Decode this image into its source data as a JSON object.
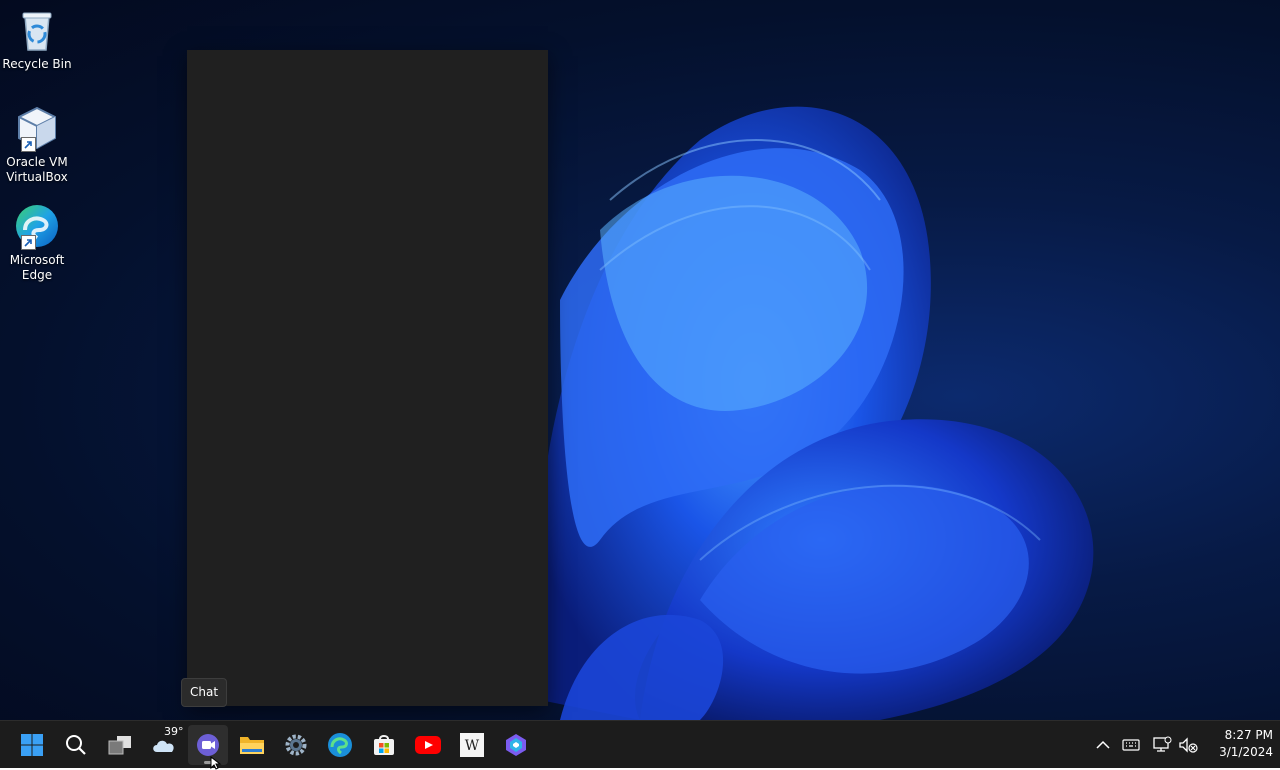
{
  "desktop": {
    "icons": [
      {
        "id": "recycle-bin",
        "label": "Recycle Bin"
      },
      {
        "id": "virtualbox",
        "label_line1": "Oracle VM",
        "label_line2": "VirtualBox"
      },
      {
        "id": "edge",
        "label_line1": "Microsoft",
        "label_line2": "Edge"
      }
    ]
  },
  "tooltip": {
    "text": "Chat"
  },
  "taskbar": {
    "apps": [
      {
        "name": "start",
        "icon": "windows-logo-icon"
      },
      {
        "name": "search",
        "icon": "search-icon"
      },
      {
        "name": "task-view",
        "icon": "task-view-icon"
      },
      {
        "name": "widgets",
        "icon": "cloud-icon"
      },
      {
        "name": "chat",
        "icon": "chat-icon",
        "active": true
      },
      {
        "name": "file-explorer",
        "icon": "folder-icon"
      },
      {
        "name": "settings",
        "icon": "gear-icon"
      },
      {
        "name": "edge",
        "icon": "edge-icon"
      },
      {
        "name": "microsoft-store",
        "icon": "store-icon"
      },
      {
        "name": "youtube",
        "icon": "youtube-icon"
      },
      {
        "name": "wikipedia",
        "icon": "wikipedia-icon"
      },
      {
        "name": "copilot",
        "icon": "copilot-icon"
      }
    ],
    "weather": {
      "temp": "39°"
    },
    "clock": {
      "time": "8:27 PM",
      "date": "3/1/2024"
    }
  },
  "colors": {
    "accent": "#0078d4",
    "taskbar_bg": "#1c1c1c",
    "flyout_bg": "#202020"
  }
}
